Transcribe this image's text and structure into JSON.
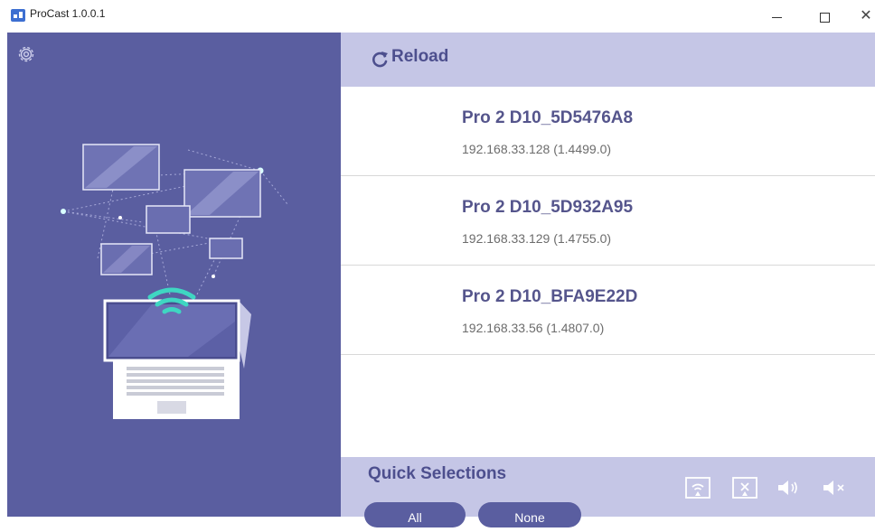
{
  "window": {
    "title": "ProCast 1.0.0.1"
  },
  "toolbar": {
    "reload_label": "Reload"
  },
  "devices": [
    {
      "name": "Pro 2 D10_5D5476A8",
      "address": "192.168.33.128 (1.4499.0)"
    },
    {
      "name": "Pro 2 D10_5D932A95",
      "address": "192.168.33.129 (1.4755.0)"
    },
    {
      "name": "Pro 2 D10_BFA9E22D",
      "address": "192.168.33.56 (1.4807.0)"
    }
  ],
  "quick": {
    "title": "Quick Selections",
    "all_label": "All",
    "none_label": "None"
  },
  "icons": [
    "app-logo-icon",
    "minimize-icon",
    "maximize-icon",
    "close-icon",
    "gear-icon",
    "reload-icon",
    "cast-screen-icon",
    "stop-cast-icon",
    "volume-icon",
    "mute-icon"
  ],
  "colors": {
    "panel": "#5a5ea0",
    "accent_bar": "#c5c6e6",
    "title_text": "#4d4f8e",
    "device_name": "#55558c",
    "wifi": "#3fd6c2"
  }
}
